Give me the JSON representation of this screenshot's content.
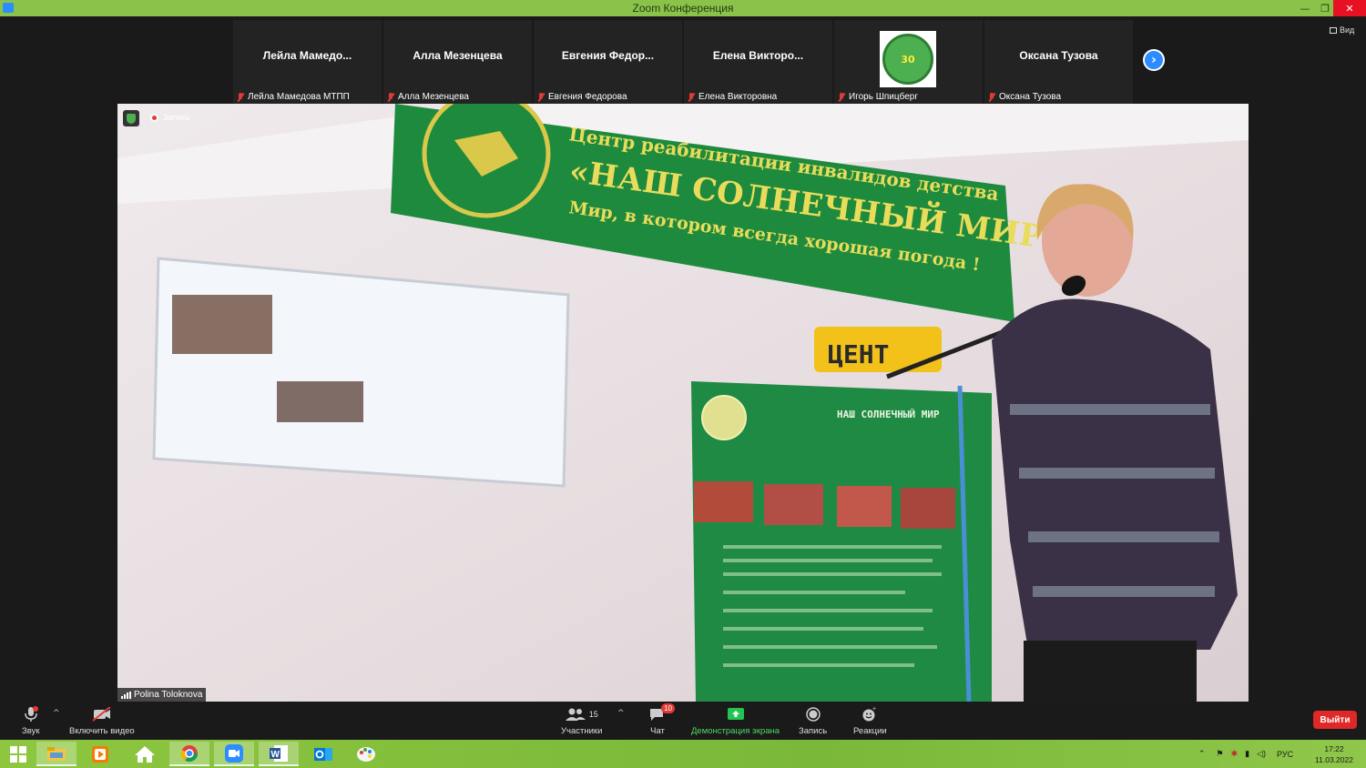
{
  "window": {
    "title": "Zoom Конференция"
  },
  "thumbnails": [
    {
      "display_name": "Лейла  Мамедо...",
      "label": "Лейла Мамедова МТПП"
    },
    {
      "display_name": "Алла Мезенцева",
      "label": "Алла Мезенцева"
    },
    {
      "display_name": "Евгения  Федор...",
      "label": "Евгения Федорова"
    },
    {
      "display_name": "Елена  Викторо...",
      "label": "Елена Викторовна"
    },
    {
      "display_name": "",
      "label": "Игорь Шпицберг",
      "logo_text": "30"
    },
    {
      "display_name": "Оксана Тузова",
      "label": "Оксана Тузова"
    }
  ],
  "view_label": "Вид",
  "video": {
    "recording_label": "Запись",
    "speaker_name": "Polina Toloknova",
    "banner_line1": "Центр реабилитации инвалидов детства",
    "banner_line2": "«НАШ СОЛНЕЧНЫЙ МИР»",
    "banner_line3": "Мир, в котором всегда хорошая погода !",
    "sign_text": "ЦЕНТ",
    "poster_text": "НАШ СОЛНЕЧНЫЙ МИР"
  },
  "toolbar": {
    "audio": "Звук",
    "video": "Включить видео",
    "participants": "Участники",
    "participants_count": "15",
    "chat": "Чат",
    "chat_badge": "10",
    "share": "Демонстрация экрана",
    "record": "Запись",
    "reactions": "Реакции",
    "leave": "Выйти"
  },
  "taskbar": {
    "lang": "РУС",
    "time": "17:22",
    "date": "11.03.2022"
  },
  "colors": {
    "accent": "#2d8cff",
    "titlebar": "#8bc34a",
    "leave": "#e02828",
    "share": "#4cd964"
  }
}
